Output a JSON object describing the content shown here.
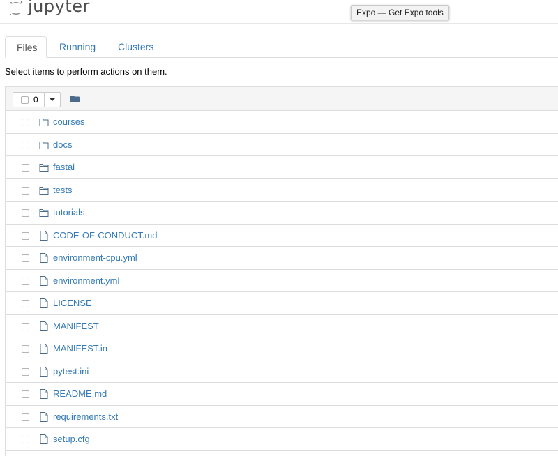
{
  "header": {
    "logo_text": "jupyter",
    "tooltip": "Expo — Get Expo tools"
  },
  "tabs": [
    {
      "label": "Files",
      "active": true
    },
    {
      "label": "Running",
      "active": false
    },
    {
      "label": "Clusters",
      "active": false
    }
  ],
  "instructions": "Select items to perform actions on them.",
  "list_header": {
    "selected_count": "0"
  },
  "items": [
    {
      "name": "courses",
      "type": "folder"
    },
    {
      "name": "docs",
      "type": "folder"
    },
    {
      "name": "fastai",
      "type": "folder"
    },
    {
      "name": "tests",
      "type": "folder"
    },
    {
      "name": "tutorials",
      "type": "folder"
    },
    {
      "name": "CODE-OF-CONDUCT.md",
      "type": "file"
    },
    {
      "name": "environment-cpu.yml",
      "type": "file"
    },
    {
      "name": "environment.yml",
      "type": "file"
    },
    {
      "name": "LICENSE",
      "type": "file"
    },
    {
      "name": "MANIFEST",
      "type": "file"
    },
    {
      "name": "MANIFEST.in",
      "type": "file"
    },
    {
      "name": "pytest.ini",
      "type": "file"
    },
    {
      "name": "README.md",
      "type": "file"
    },
    {
      "name": "requirements.txt",
      "type": "file"
    },
    {
      "name": "setup.cfg",
      "type": "file"
    },
    {
      "name": "",
      "type": "file"
    }
  ],
  "colors": {
    "link": "#337ab7",
    "border": "#dddddd",
    "icon": "#4a6b8a",
    "header_bg": "#f5f5f5"
  }
}
